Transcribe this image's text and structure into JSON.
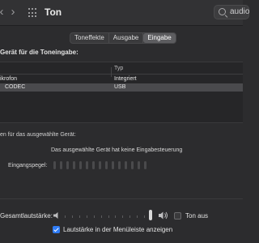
{
  "toolbar": {
    "back_icon": "chevron-left-icon",
    "forward_icon": "chevron-right-icon",
    "grid_icon": "grid-icon",
    "title": "Ton",
    "search_value": "audio"
  },
  "tabs": [
    {
      "label": "Toneffekte",
      "active": false
    },
    {
      "label": "Ausgabe",
      "active": false
    },
    {
      "label": "Eingabe",
      "active": true
    }
  ],
  "device_section": {
    "label": "Gerät für die Toneingabe:",
    "columns": [
      "",
      "Typ"
    ],
    "rows": [
      {
        "name": "ikrofon",
        "type": "Integriert",
        "selected": false
      },
      {
        "name": "CODEC",
        "type": "USB",
        "selected": true
      }
    ]
  },
  "settings": {
    "label": "en für das ausgewählte Gerät:",
    "no_controls_text": "Das ausgewählte Gerät hat keine Eingabesteuerung",
    "level_label": "Eingangspegel:",
    "level_segments": 15,
    "level_value": 0
  },
  "volume": {
    "label": "Gesamtlautstärke:",
    "value": 1.0,
    "mute_label": "Ton aus",
    "mute_checked": false,
    "menubar_label": "Lautstärke in der Menüleiste anzeigen",
    "menubar_checked": true
  },
  "colors": {
    "accent": "#2f7cf6",
    "background": "#2c2c2e"
  }
}
